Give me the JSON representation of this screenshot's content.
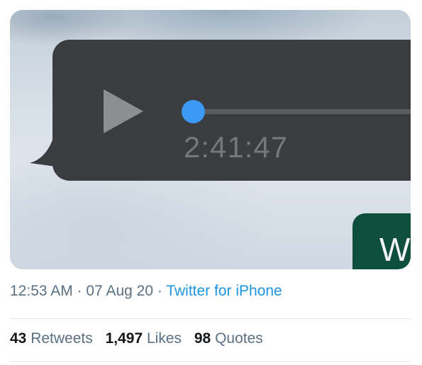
{
  "media": {
    "voice_message": {
      "duration": "2:41:47",
      "progress": 0.0,
      "play_icon": "play-icon"
    },
    "partial_bubble_text": "W"
  },
  "tweet_meta": {
    "time": "12:53 AM",
    "separator": "·",
    "date": "07 Aug 20",
    "source": "Twitter for iPhone"
  },
  "stats": [
    {
      "count": "43",
      "label": "Retweets"
    },
    {
      "count": "1,497",
      "label": "Likes"
    },
    {
      "count": "98",
      "label": "Quotes"
    }
  ],
  "colors": {
    "bubble": "#3b3c3f",
    "accent": "#3b98f3",
    "link": "#1b95e0",
    "meta_text": "#5b7083",
    "green_bubble": "#0e4e3c"
  }
}
